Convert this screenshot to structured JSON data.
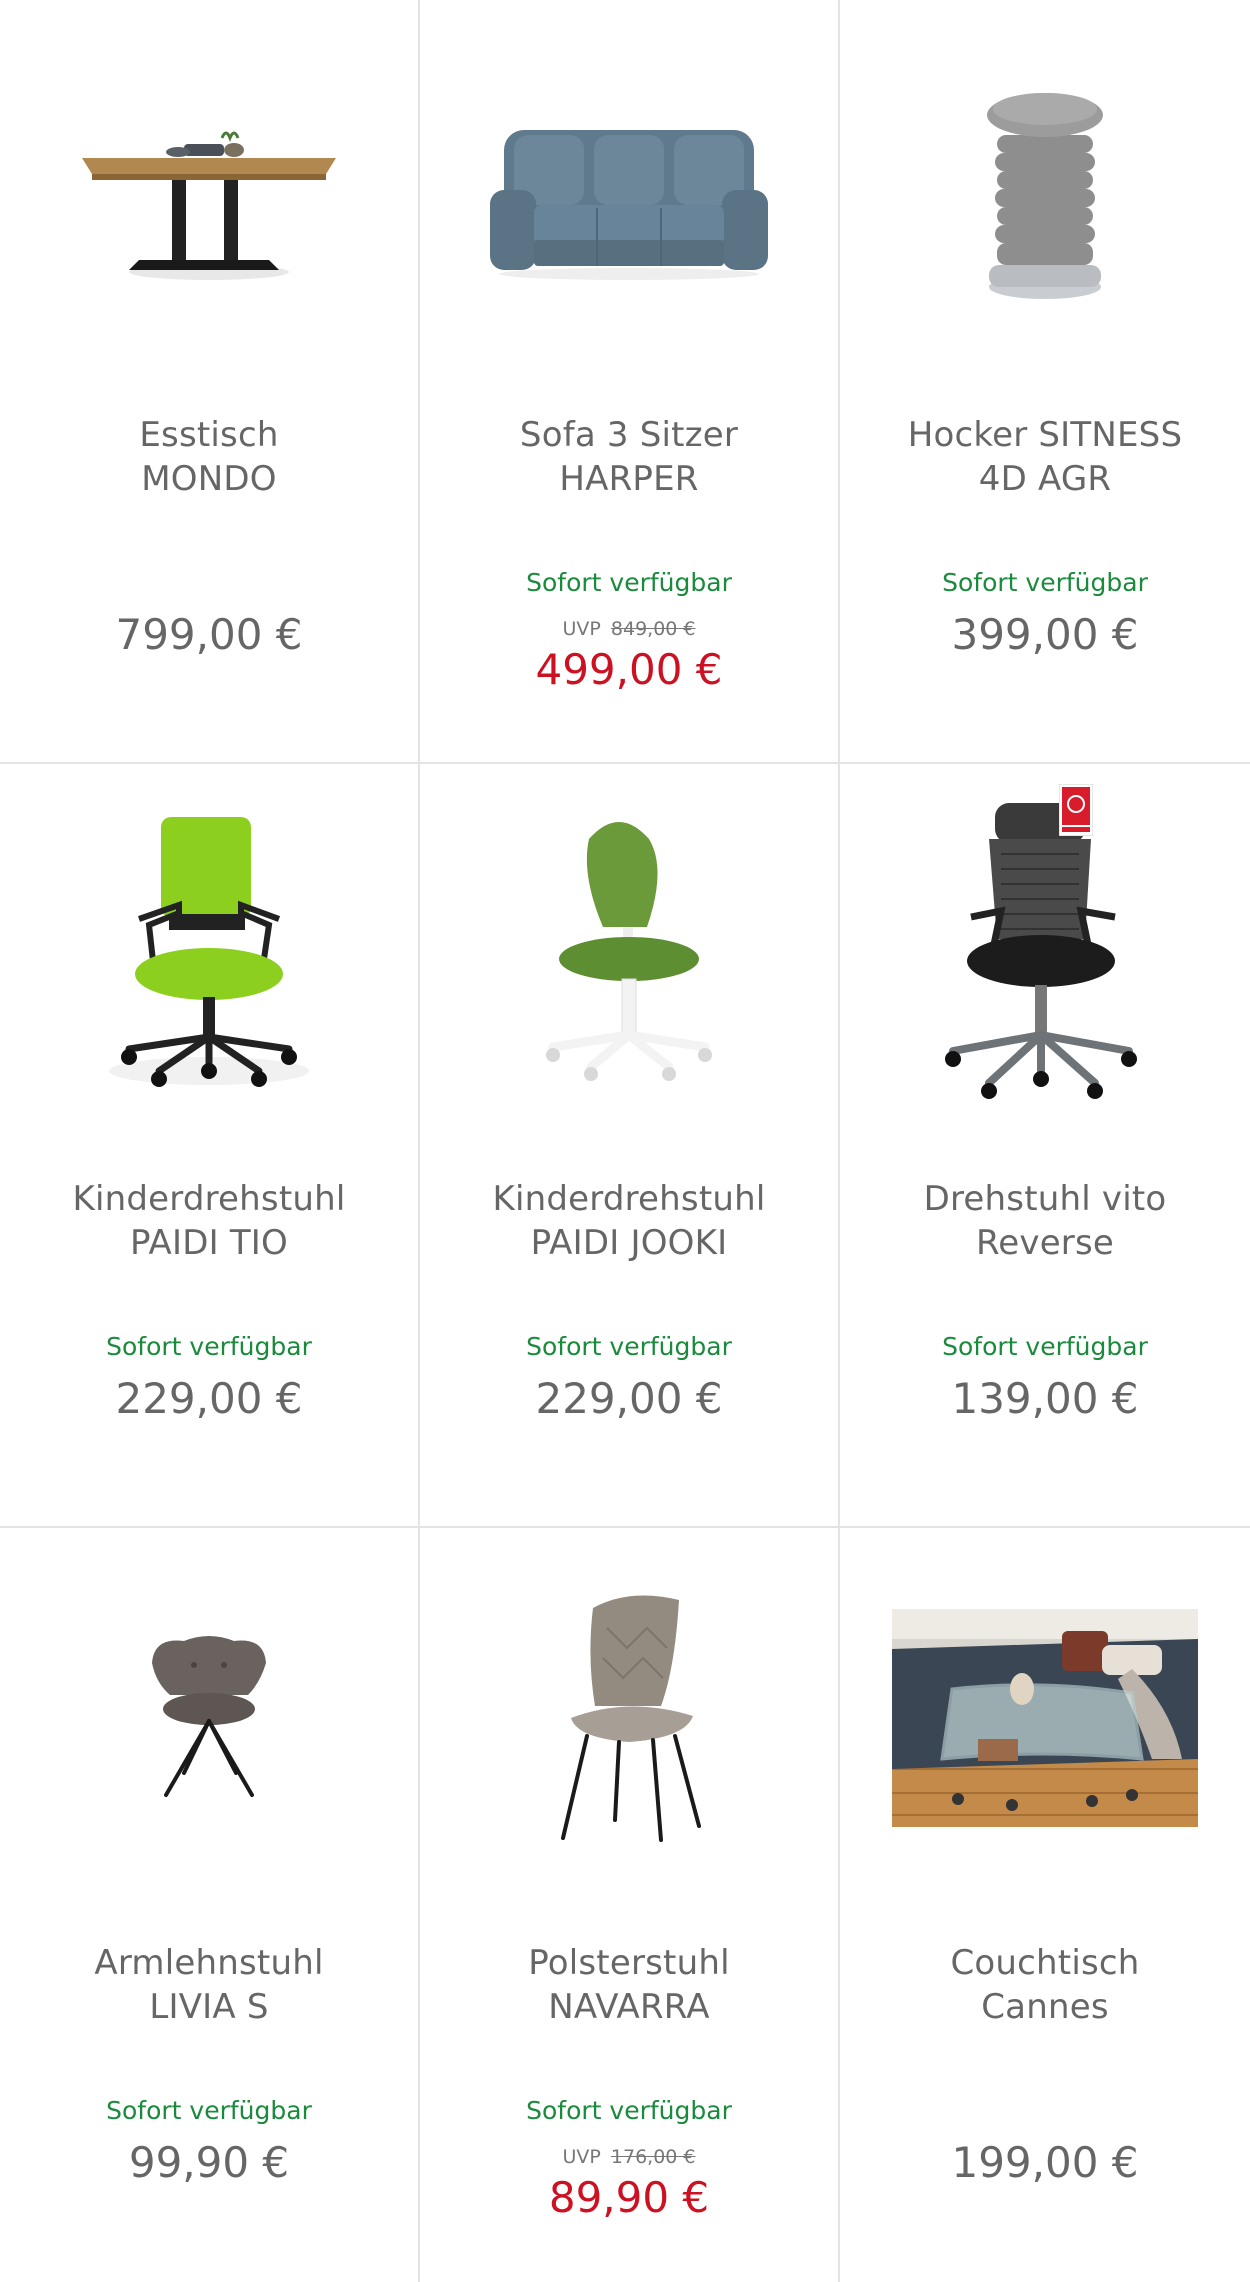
{
  "products": [
    {
      "name_line1": "Esstisch",
      "name_line2": "MONDO",
      "availability": "",
      "uvp_label": "",
      "uvp_price": "",
      "price": "799,00 €",
      "sale": false,
      "image": "dining-table"
    },
    {
      "name_line1": "Sofa 3 Sitzer",
      "name_line2": "HARPER",
      "availability": "Sofort verfügbar",
      "uvp_label": "UVP",
      "uvp_price": "849,00 €",
      "price": "499,00 €",
      "sale": true,
      "image": "sofa"
    },
    {
      "name_line1": "Hocker SITNESS",
      "name_line2": "4D AGR",
      "availability": "Sofort verfügbar",
      "uvp_label": "",
      "uvp_price": "",
      "price": "399,00 €",
      "sale": false,
      "image": "stool"
    },
    {
      "name_line1": "Kinderdrehstuhl",
      "name_line2": "PAIDI TIO",
      "availability": "Sofort verfügbar",
      "uvp_label": "",
      "uvp_price": "",
      "price": "229,00 €",
      "sale": false,
      "image": "office-chair-green"
    },
    {
      "name_line1": "Kinderdrehstuhl",
      "name_line2": "PAIDI JOOKI",
      "availability": "Sofort verfügbar",
      "uvp_label": "",
      "uvp_price": "",
      "price": "229,00 €",
      "sale": false,
      "image": "kids-chair"
    },
    {
      "name_line1": "Drehstuhl vito",
      "name_line2": "Reverse",
      "availability": "Sofort verfügbar",
      "uvp_label": "",
      "uvp_price": "",
      "price": "139,00 €",
      "sale": false,
      "image": "office-chair-black"
    },
    {
      "name_line1": "Armlehnstuhl",
      "name_line2": "LIVIA S",
      "availability": "Sofort verfügbar",
      "uvp_label": "",
      "uvp_price": "",
      "price": "99,90 €",
      "sale": false,
      "image": "armchair"
    },
    {
      "name_line1": "Polsterstuhl",
      "name_line2": "NAVARRA",
      "availability": "Sofort verfügbar",
      "uvp_label": "UVP",
      "uvp_price": "176,00 €",
      "price": "89,90 €",
      "sale": true,
      "image": "upholstered-chair"
    },
    {
      "name_line1": "Couchtisch",
      "name_line2": "Cannes",
      "availability": "",
      "uvp_label": "",
      "uvp_price": "",
      "price": "199,00 €",
      "sale": false,
      "image": "coffee-table-scene"
    }
  ],
  "colors": {
    "availability": "#1a8a3c",
    "sale_price": "#cc1122",
    "regular_price": "#666666",
    "divider": "#e3e3e3"
  }
}
